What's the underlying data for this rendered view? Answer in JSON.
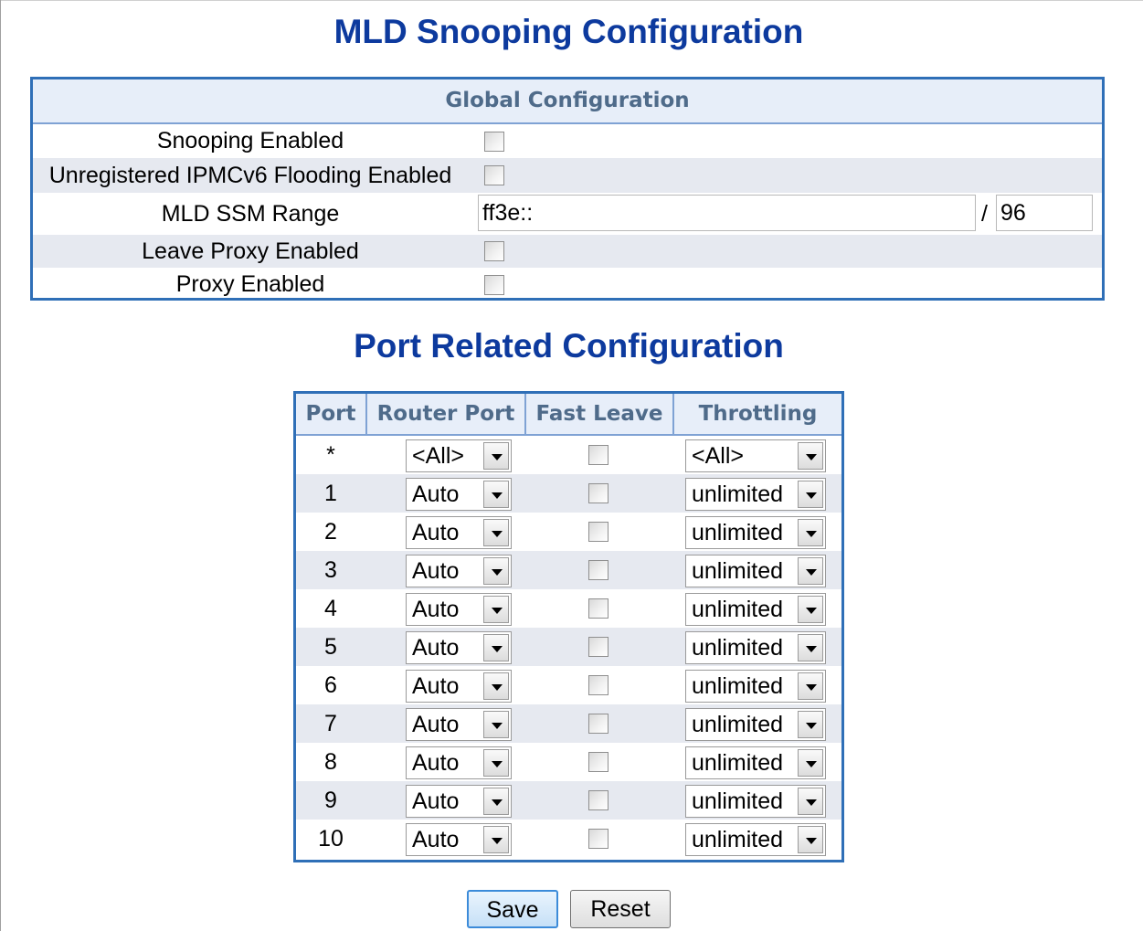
{
  "page": {
    "title": "MLD Snooping Configuration"
  },
  "global": {
    "header": "Global Configuration",
    "rows": [
      {
        "label": "Snooping Enabled",
        "type": "checkbox",
        "checked": false
      },
      {
        "label": "Unregistered IPMCv6 Flooding Enabled",
        "type": "checkbox",
        "checked": false
      },
      {
        "label": "MLD SSM Range",
        "type": "range",
        "address": "ff3e::",
        "separator": "/",
        "prefix": "96"
      },
      {
        "label": "Leave Proxy Enabled",
        "type": "checkbox",
        "checked": false
      },
      {
        "label": "Proxy Enabled",
        "type": "checkbox",
        "checked": false
      }
    ]
  },
  "port_config": {
    "title": "Port Related Configuration",
    "headers": [
      "Port",
      "Router Port",
      "Fast Leave",
      "Throttling"
    ],
    "rows": [
      {
        "port": "*",
        "router_port": "<All>",
        "fast_leave": false,
        "throttling": "<All>"
      },
      {
        "port": "1",
        "router_port": "Auto",
        "fast_leave": false,
        "throttling": "unlimited"
      },
      {
        "port": "2",
        "router_port": "Auto",
        "fast_leave": false,
        "throttling": "unlimited"
      },
      {
        "port": "3",
        "router_port": "Auto",
        "fast_leave": false,
        "throttling": "unlimited"
      },
      {
        "port": "4",
        "router_port": "Auto",
        "fast_leave": false,
        "throttling": "unlimited"
      },
      {
        "port": "5",
        "router_port": "Auto",
        "fast_leave": false,
        "throttling": "unlimited"
      },
      {
        "port": "6",
        "router_port": "Auto",
        "fast_leave": false,
        "throttling": "unlimited"
      },
      {
        "port": "7",
        "router_port": "Auto",
        "fast_leave": false,
        "throttling": "unlimited"
      },
      {
        "port": "8",
        "router_port": "Auto",
        "fast_leave": false,
        "throttling": "unlimited"
      },
      {
        "port": "9",
        "router_port": "Auto",
        "fast_leave": false,
        "throttling": "unlimited"
      },
      {
        "port": "10",
        "router_port": "Auto",
        "fast_leave": false,
        "throttling": "unlimited"
      }
    ]
  },
  "buttons": {
    "save": "Save",
    "reset": "Reset"
  },
  "colors": {
    "title": "#0d3a9e",
    "table_border": "#2f6fb7",
    "header_bg": "#e7eef9",
    "alt_row_bg": "#e6e9f0"
  }
}
